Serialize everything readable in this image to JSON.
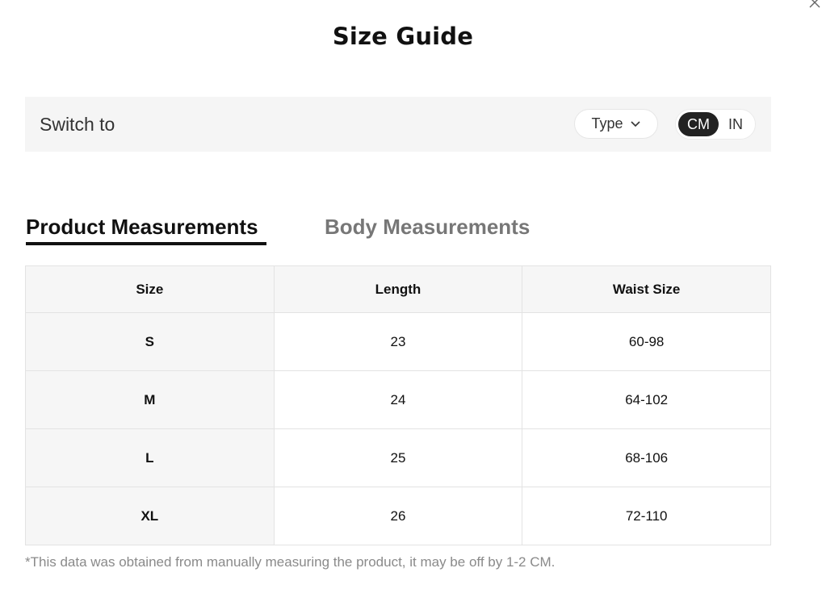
{
  "dialog": {
    "title": "Size Guide",
    "close_icon": "close-icon"
  },
  "switch_bar": {
    "label": "Switch to",
    "type_dropdown": {
      "label": "Type",
      "icon": "chevron-down-icon"
    },
    "units": {
      "active": "CM",
      "inactive": "IN"
    }
  },
  "tabs": [
    {
      "label": "Product Measurements",
      "active": true
    },
    {
      "label": "Body Measurements",
      "active": false
    }
  ],
  "table": {
    "headers": [
      "Size",
      "Length",
      "Waist Size"
    ],
    "rows": [
      [
        "S",
        "23",
        "60-98"
      ],
      [
        "M",
        "24",
        "64-102"
      ],
      [
        "L",
        "25",
        "68-106"
      ],
      [
        "XL",
        "26",
        "72-110"
      ]
    ]
  },
  "note": "*This data was obtained from manually measuring the product, it may be off by 1-2 CM.",
  "colors": {
    "accent": "#222222",
    "muted_text": "#8a8a8a",
    "panel_bg": "#f5f5f5"
  }
}
